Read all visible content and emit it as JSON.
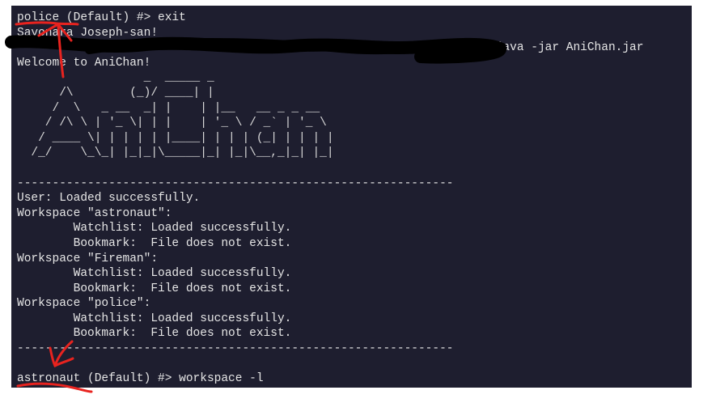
{
  "terminal": {
    "lines": [
      "police (Default) #> exit",
      "Sayonara Joseph-san!",
      "",
      "Welcome to AniChan!",
      "                  _  _____ _",
      "      /\\        (_)/ ____| |",
      "     /  \\   _ __  _| |    | |__   __ _ _ __",
      "    / /\\ \\ | '_ \\| | |    | '_ \\ / _` | '_ \\",
      "   / ____ \\| | | | | |____| | | | (_| | | | |",
      "  /_/    \\_\\_| |_|_|\\_____|_| |_|\\__,_|_| |_|",
      "",
      "--------------------------------------------------------------",
      "User: Loaded successfully.",
      "Workspace \"astronaut\":",
      "        Watchlist: Loaded successfully.",
      "        Bookmark:  File does not exist.",
      "Workspace \"Fireman\":",
      "        Watchlist: Loaded successfully.",
      "        Bookmark:  File does not exist.",
      "Workspace \"police\":",
      "        Watchlist: Loaded successfully.",
      "        Bookmark:  File does not exist.",
      "--------------------------------------------------------------",
      "",
      "astronaut (Default) #> workspace -l"
    ],
    "command_prompt_suffix": "$ java -jar AniChan.jar"
  },
  "colors": {
    "terminal_bg": "#1e1e2f",
    "text": "#e6e6e6",
    "annotation": "#e8231f",
    "redaction": "#000000"
  }
}
